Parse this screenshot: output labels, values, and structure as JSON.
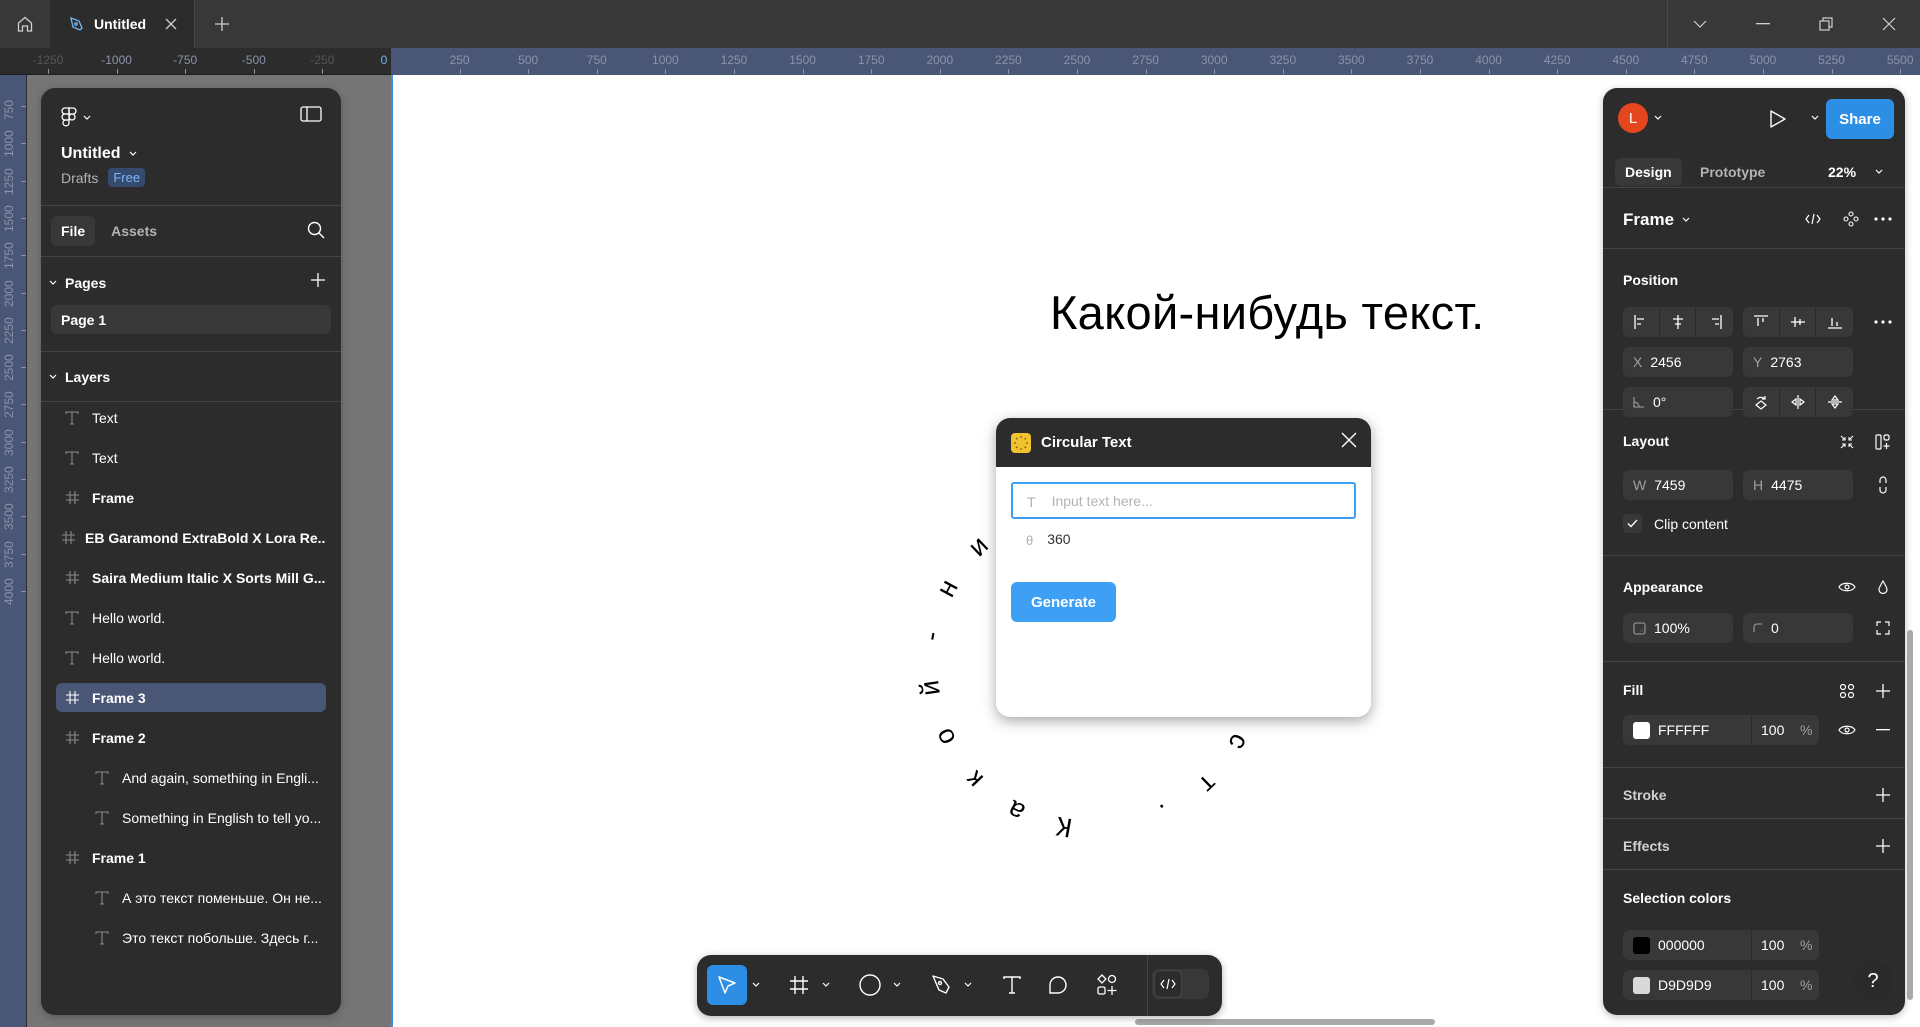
{
  "titlebar": {
    "tab_title": "Untitled",
    "icons": [
      "home-icon",
      "figma-pen-icon",
      "close-icon",
      "plus-icon",
      "chevron-down-icon",
      "minimize-icon",
      "restore-icon",
      "close-window-icon"
    ]
  },
  "rulers": {
    "horizontal_labels": [
      "-1250",
      "-1000",
      "-750",
      "-500",
      "-250",
      "0",
      "250",
      "500",
      "750",
      "1000",
      "1250",
      "1500",
      "1750",
      "2000",
      "2250",
      "2500",
      "2750",
      "3000",
      "3250",
      "3500",
      "3750",
      "4000",
      "4250",
      "4500",
      "4750",
      "5000",
      "5250",
      "5500"
    ],
    "vertical_labels": [
      "750",
      "1000",
      "1250",
      "1500",
      "1750",
      "2000",
      "2250",
      "2500",
      "2750",
      "3000",
      "3250",
      "3500",
      "3750",
      "4000"
    ]
  },
  "left_panel": {
    "file_name": "Untitled",
    "location": "Drafts",
    "plan_badge": "Free",
    "tabs": [
      {
        "label": "File",
        "active": true
      },
      {
        "label": "Assets",
        "active": false
      }
    ],
    "pages_title": "Pages",
    "pages": [
      "Page 1"
    ],
    "layers_title": "Layers",
    "layers": [
      {
        "name": "Text",
        "type": "text",
        "indent": 0,
        "bold": false,
        "selected": false
      },
      {
        "name": "Text",
        "type": "text",
        "indent": 0,
        "bold": false,
        "selected": false
      },
      {
        "name": "Frame",
        "type": "frame",
        "indent": 0,
        "bold": true,
        "selected": false
      },
      {
        "name": "EB Garamond ExtraBold X Lora Re...",
        "type": "frame",
        "indent": 0,
        "bold": true,
        "selected": false
      },
      {
        "name": "Saira Medium Italic X Sorts Mill G...",
        "type": "frame",
        "indent": 0,
        "bold": true,
        "selected": false
      },
      {
        "name": "Hello world.",
        "type": "text",
        "indent": 0,
        "bold": false,
        "selected": false
      },
      {
        "name": "Hello world.",
        "type": "text",
        "indent": 0,
        "bold": false,
        "selected": false
      },
      {
        "name": "Frame 3",
        "type": "frame",
        "indent": 0,
        "bold": true,
        "selected": true
      },
      {
        "name": "Frame 2",
        "type": "frame",
        "indent": 0,
        "bold": true,
        "selected": false
      },
      {
        "name": "And again, something in Engli...",
        "type": "text",
        "indent": 1,
        "bold": false,
        "selected": false
      },
      {
        "name": "Something in English to tell yo...",
        "type": "text",
        "indent": 1,
        "bold": false,
        "selected": false
      },
      {
        "name": "Frame 1",
        "type": "frame",
        "indent": 0,
        "bold": true,
        "selected": false
      },
      {
        "name": "А это текст поменьше. Он не...",
        "type": "text",
        "indent": 1,
        "bold": false,
        "selected": false
      },
      {
        "name": "Это текст побольше. Здесь г...",
        "type": "text",
        "indent": 1,
        "bold": false,
        "selected": false
      }
    ]
  },
  "canvas": {
    "heading": "Какой-нибудь текст.",
    "circular_text": "Какой-нибудь текст.",
    "arrow_color": "#e0192d",
    "frame_fill": "#FFFFFF",
    "stray_glyph": "y"
  },
  "plugin_dialog": {
    "title": "Circular Text",
    "text_placeholder": "Input text here...",
    "text_value": "",
    "text_icon": "T",
    "angle_icon": "θ",
    "angle_value": "360",
    "generate_label": "Generate",
    "accent": "#3ea0f5"
  },
  "right_panel": {
    "avatar_initial": "L",
    "avatar_color": "#e5461e",
    "share_label": "Share",
    "share_color": "#2d8ee6",
    "tabs": [
      {
        "label": "Design",
        "active": true
      },
      {
        "label": "Prototype",
        "active": false
      }
    ],
    "zoom": "22%",
    "selection_type": "Frame",
    "position": {
      "title": "Position",
      "x_label": "X",
      "x": "2456",
      "y_label": "Y",
      "y": "2763",
      "rotation": "0°"
    },
    "layout": {
      "title": "Layout",
      "w_label": "W",
      "w": "7459",
      "h_label": "H",
      "h": "4475",
      "clip_content_label": "Clip content",
      "clip_content": true
    },
    "appearance": {
      "title": "Appearance",
      "opacity": "100%",
      "corner_radius": "0"
    },
    "fill": {
      "title": "Fill",
      "color": "FFFFFF",
      "swatch": "#FFFFFF",
      "opacity": "100",
      "unit": "%"
    },
    "stroke_title": "Stroke",
    "effects_title": "Effects",
    "selection_colors": {
      "title": "Selection colors",
      "items": [
        {
          "hex": "000000",
          "swatch": "#000000",
          "opacity": "100",
          "unit": "%"
        },
        {
          "hex": "D9D9D9",
          "swatch": "#D9D9D9",
          "opacity": "100",
          "unit": "%"
        }
      ]
    },
    "help_label": "?"
  },
  "toolbar": {
    "tools": [
      {
        "name": "move",
        "active": true,
        "has_menu": true
      },
      {
        "name": "frame",
        "active": false,
        "has_menu": true
      },
      {
        "name": "ellipse",
        "active": false,
        "has_menu": true
      },
      {
        "name": "pen",
        "active": false,
        "has_menu": true
      },
      {
        "name": "text",
        "active": false,
        "has_menu": false
      },
      {
        "name": "comment",
        "active": false,
        "has_menu": false
      },
      {
        "name": "actions",
        "active": false,
        "has_menu": false
      }
    ],
    "dev_mode": false
  }
}
